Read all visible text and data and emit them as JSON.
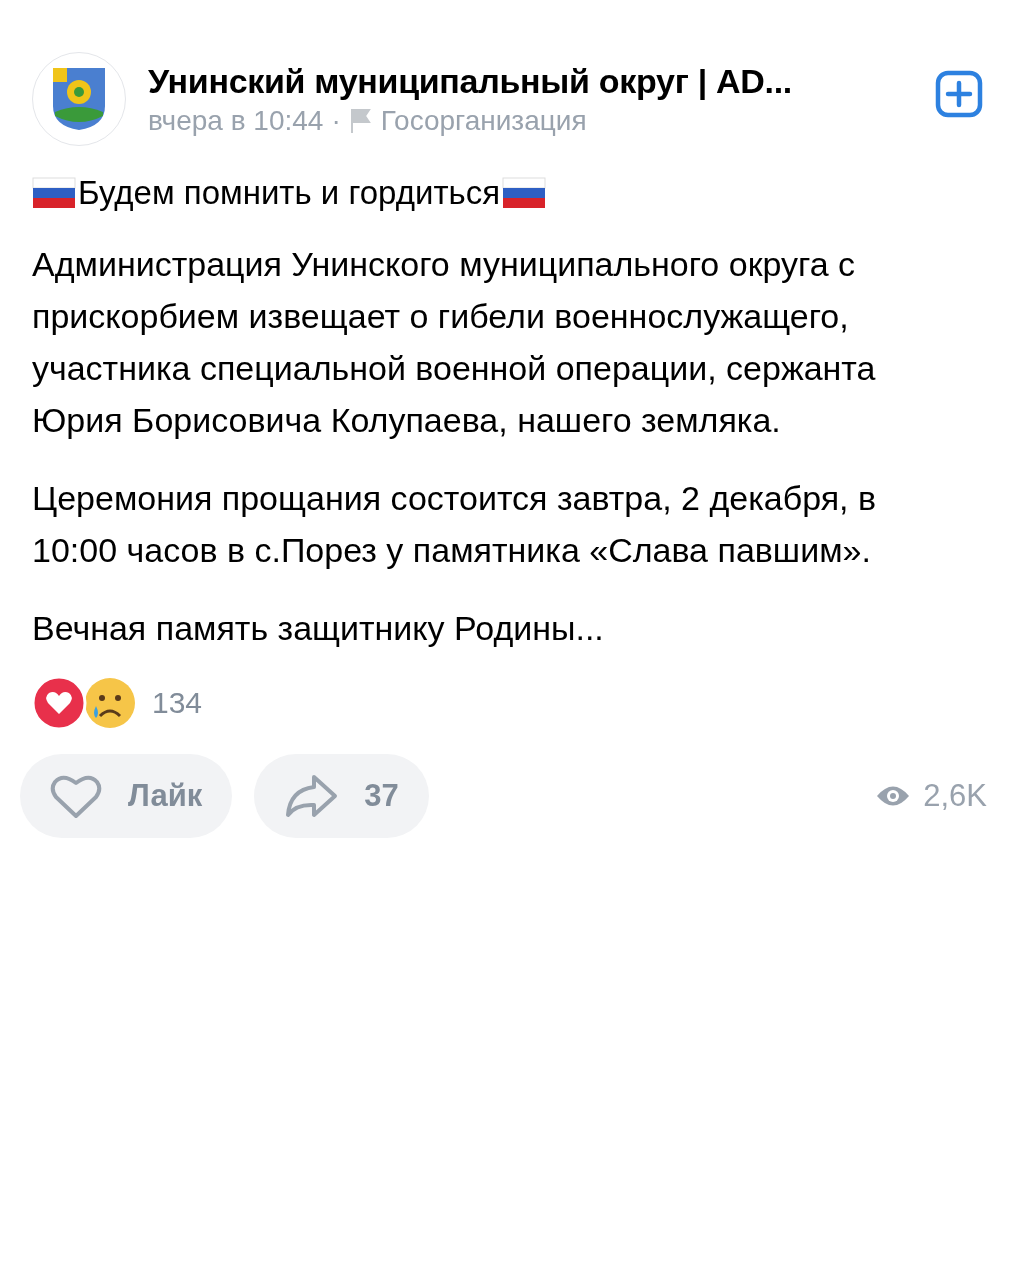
{
  "post": {
    "author": "Унинский муниципальный округ | AD...",
    "time": "вчера в 10:44",
    "separator": "·",
    "badge": "Госорганизация",
    "headline": "Будем помнить и гордиться",
    "paragraphs": [
      "Администрация Унинского муниципального округа с прискорбием извещает о гибели военнослужащего, участника специальной военной операции, сержанта Юрия Борисовича Колупаева, нашего земляка.",
      "Церемония прощания состоится завтра, 2 декабря, в 10:00 часов в с.Порез у памятника «Слава павшим».",
      "Вечная память защитнику Родины..."
    ],
    "reactions": {
      "count": "134"
    },
    "actions": [
      {
        "kind": "like",
        "label": "Лайк"
      },
      {
        "kind": "share",
        "label": "37"
      }
    ],
    "views": "2,6K"
  }
}
